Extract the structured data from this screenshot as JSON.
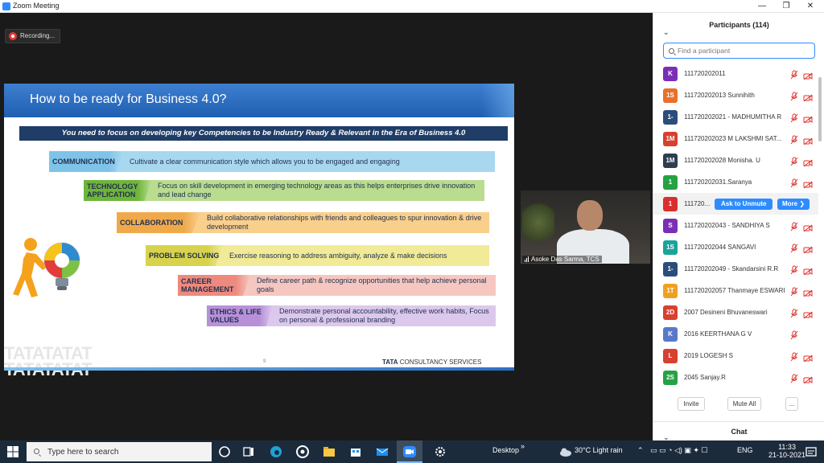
{
  "window": {
    "title": "Zoom Meeting",
    "controls": [
      "—",
      "❐",
      "✕"
    ]
  },
  "recording": {
    "label": "Recording..."
  },
  "slide": {
    "title": "How to be ready for Business 4.0?",
    "focus": "You  need to focus on developing key Competencies to be Industry Ready & Relevant in the Era of Business 4.0",
    "rows": [
      {
        "label": "COMMUNICATION",
        "text": "Cultivate a clear communication style which allows you to be engaged and engaging",
        "color": "#a8d8f0",
        "labelColor": "#7fc4e8"
      },
      {
        "label": "TECHNOLOGY APPLICATION",
        "text": "Focus on skill development in emerging technology areas as this helps enterprises drive innovation and lead change",
        "color": "#b9dc8f",
        "labelColor": "#6fb53a"
      },
      {
        "label": "COLLABORATION",
        "text": "Build collaborative relationships with friends and colleagues to spur innovation & drive development",
        "color": "#f9cf8c",
        "labelColor": "#f0a94a"
      },
      {
        "label": "PROBLEM SOLVING",
        "text": "Exercise reasoning to address ambiguity, analyze & make decisions",
        "color": "#f1ea96",
        "labelColor": "#d7d34c"
      },
      {
        "label": "CAREER MANAGEMENT",
        "text": "Define career path & recognize opportunities that help achieve personal goals",
        "color": "#f6c7c0",
        "labelColor": "#ee8a7d"
      },
      {
        "label": "ETHICS & LIFE VALUES",
        "text": "Demonstrate personal accountability, effective work habits, Focus on personal & professional branding",
        "color": "#dcc8ec",
        "labelColor": "#b791d8"
      }
    ],
    "watermark": "TATATATAT",
    "page_number": "9",
    "footer_brand_bold": "TATA",
    "footer_brand": " CONSULTANCY SERVICES"
  },
  "video": {
    "name": "Asoke Das Sarma, TCS"
  },
  "participants": {
    "header": "Participants (114)",
    "search_placeholder": "Find a participant",
    "ask_unmute": "Ask to Unmute",
    "more": "More ❯",
    "list": [
      {
        "initials": "K",
        "name": "111720202011",
        "color": "#7b2fb5",
        "cam": true
      },
      {
        "initials": "1S",
        "name": "111720202013 Sunnihith",
        "color": "#e8702a",
        "cam": true
      },
      {
        "initials": "1-",
        "name": "111720202021 - MADHUMITHA R",
        "color": "#2b4d7a",
        "cam": true
      },
      {
        "initials": "1M",
        "name": "111720202023 M LAKSHMI SAT...",
        "color": "#d8402f",
        "cam": true
      },
      {
        "initials": "1M",
        "name": "111720202028 Monisha. U",
        "color": "#2d3e50",
        "cam": true
      },
      {
        "initials": "1",
        "name": "111720202031.Saranya",
        "color": "#25a244",
        "cam": true
      },
      {
        "initials": "1",
        "name": "111720...",
        "color": "#d8302f",
        "cam": false,
        "hover": true
      },
      {
        "initials": "S",
        "name": "111720202043 - SANDHIYA S",
        "color": "#7b2fb5",
        "cam": true
      },
      {
        "initials": "1S",
        "name": "111720202044 SANGAVI",
        "color": "#1aa39a",
        "cam": true
      },
      {
        "initials": "1-",
        "name": "111720202049 - Skandarsini R.R",
        "color": "#2b4d7a",
        "cam": true
      },
      {
        "initials": "1T",
        "name": "111720202057 Thanmaye ESWARI",
        "color": "#f0a020",
        "cam": true
      },
      {
        "initials": "2D",
        "name": "2007 Desineni Bhuvaneswari",
        "color": "#d8402f",
        "cam": true
      },
      {
        "initials": "K",
        "name": "2016 KEERTHANA G V",
        "color": "#5a78c8",
        "cam": false
      },
      {
        "initials": "L",
        "name": "2019 LOGESH S",
        "color": "#d8402f",
        "cam": true
      },
      {
        "initials": "2S",
        "name": "2045 Sanjay.R",
        "color": "#25a244",
        "cam": true
      }
    ],
    "invite": "Invite",
    "mute_all": "Mute All",
    "ellipsis": "...",
    "chat": "Chat"
  },
  "taskbar": {
    "search_placeholder": "Type here to search",
    "desktop": "Desktop",
    "weather": "30°C  Light rain",
    "lang": "ENG",
    "time": "11:33",
    "date": "21-10-2021"
  },
  "colors": {
    "accent": "#2d8cff",
    "mic_muted": "#e0302f"
  }
}
